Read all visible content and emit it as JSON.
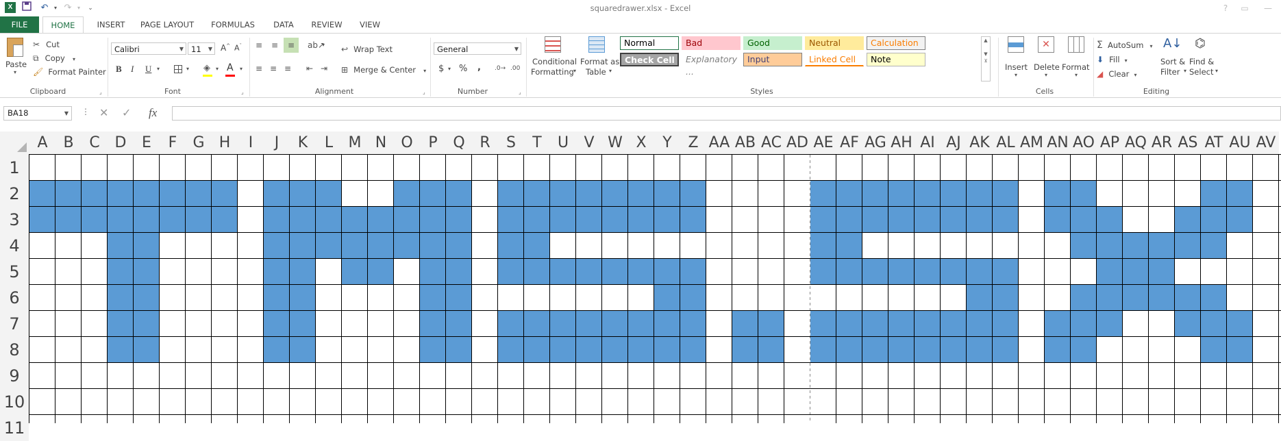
{
  "app": {
    "title": "squaredrawer.xlsx - Excel",
    "help": "?",
    "restore": "▭",
    "minimize": "—"
  },
  "tabs": [
    "FILE",
    "HOME",
    "INSERT",
    "PAGE LAYOUT",
    "FORMULAS",
    "DATA",
    "REVIEW",
    "VIEW"
  ],
  "active_tab": "HOME",
  "ribbon": {
    "clipboard": {
      "label": "Clipboard",
      "paste": "Paste",
      "cut": "Cut",
      "copy": "Copy",
      "format_painter": "Format Painter"
    },
    "font": {
      "label": "Font",
      "font_name": "Calibri",
      "font_size": "11",
      "bold": "B",
      "italic": "I",
      "underline": "U"
    },
    "alignment": {
      "label": "Alignment",
      "wrap_text": "Wrap Text",
      "merge_center": "Merge & Center"
    },
    "number": {
      "label": "Number",
      "format": "General",
      "currency": "$",
      "percent": "%",
      "comma": ","
    },
    "styles": {
      "label": "Styles",
      "conditional_formatting_1": "Conditional",
      "conditional_formatting_2": "Formatting",
      "format_as_table_1": "Format as",
      "format_as_table_2": "Table",
      "gallery": [
        {
          "name": "Normal",
          "bg": "#ffffff",
          "fg": "#000000",
          "border": "#217346"
        },
        {
          "name": "Bad",
          "bg": "#ffc7ce",
          "fg": "#9c0006",
          "border": "#ffc7ce"
        },
        {
          "name": "Good",
          "bg": "#c6efce",
          "fg": "#006100",
          "border": "#c6efce"
        },
        {
          "name": "Neutral",
          "bg": "#ffeb9c",
          "fg": "#9c5700",
          "border": "#ffeb9c"
        },
        {
          "name": "Calculation",
          "bg": "#f2f2f2",
          "fg": "#fa7d00",
          "border": "#7f7f7f"
        },
        {
          "name": "Check Cell",
          "bg": "#a5a5a5",
          "fg": "#ffffff",
          "border": "#3f3f3f"
        },
        {
          "name": "Explanatory ...",
          "bg": "#ffffff",
          "fg": "#7f7f7f",
          "border": "#ffffff"
        },
        {
          "name": "Input",
          "bg": "#ffcc99",
          "fg": "#3f3f76",
          "border": "#7f7f7f"
        },
        {
          "name": "Linked Cell",
          "bg": "#ffffff",
          "fg": "#fa7d00",
          "border": "#ffffff"
        },
        {
          "name": "Note",
          "bg": "#ffffcc",
          "fg": "#000000",
          "border": "#b2b2b2"
        }
      ]
    },
    "cells": {
      "label": "Cells",
      "insert": "Insert",
      "delete": "Delete",
      "format": "Format"
    },
    "editing": {
      "label": "Editing",
      "autosum": "AutoSum",
      "fill": "Fill",
      "clear": "Clear",
      "sort_1": "Sort &",
      "sort_2": "Filter",
      "find_1": "Find &",
      "find_2": "Select"
    }
  },
  "formula_bar": {
    "name_box": "BA18",
    "cancel": "✕",
    "enter": "✓",
    "fx": "fx",
    "value": ""
  },
  "sheet": {
    "fill_color": "#5b9bd5",
    "columns": [
      "A",
      "B",
      "C",
      "D",
      "E",
      "F",
      "G",
      "H",
      "I",
      "J",
      "K",
      "L",
      "M",
      "N",
      "O",
      "P",
      "Q",
      "R",
      "S",
      "T",
      "U",
      "V",
      "W",
      "X",
      "Y",
      "Z",
      "AA",
      "AB",
      "AC",
      "AD",
      "AE",
      "AF",
      "AG",
      "AH",
      "AI",
      "AJ",
      "AK",
      "AL",
      "AM",
      "AN",
      "AO",
      "AP",
      "AQ",
      "AR",
      "AS",
      "AT",
      "AU",
      "AV"
    ],
    "rows": [
      "1",
      "2",
      "3",
      "4",
      "5",
      "6",
      "7",
      "8",
      "9",
      "10",
      "11"
    ],
    "filled": {
      "2": [
        "A",
        "B",
        "C",
        "D",
        "E",
        "F",
        "G",
        "H",
        "J",
        "K",
        "L",
        "O",
        "P",
        "Q",
        "S",
        "T",
        "U",
        "V",
        "W",
        "X",
        "Y",
        "Z",
        "AE",
        "AF",
        "AG",
        "AH",
        "AI",
        "AJ",
        "AK",
        "AL",
        "AN",
        "AO",
        "AT",
        "AU"
      ],
      "3": [
        "A",
        "B",
        "C",
        "D",
        "E",
        "F",
        "G",
        "H",
        "J",
        "K",
        "L",
        "M",
        "N",
        "O",
        "P",
        "Q",
        "S",
        "T",
        "U",
        "V",
        "W",
        "X",
        "Y",
        "Z",
        "AE",
        "AF",
        "AG",
        "AH",
        "AI",
        "AJ",
        "AK",
        "AL",
        "AN",
        "AO",
        "AP",
        "AS",
        "AT",
        "AU"
      ],
      "4": [
        "D",
        "E",
        "J",
        "K",
        "L",
        "M",
        "N",
        "O",
        "P",
        "Q",
        "S",
        "T",
        "AE",
        "AF",
        "AO",
        "AP",
        "AQ",
        "AR",
        "AS",
        "AT"
      ],
      "5": [
        "D",
        "E",
        "J",
        "K",
        "M",
        "N",
        "P",
        "Q",
        "S",
        "T",
        "U",
        "V",
        "W",
        "X",
        "Y",
        "Z",
        "AE",
        "AF",
        "AG",
        "AH",
        "AI",
        "AJ",
        "AK",
        "AL",
        "AP",
        "AQ",
        "AR"
      ],
      "6": [
        "D",
        "E",
        "J",
        "K",
        "P",
        "Q",
        "Y",
        "Z",
        "AK",
        "AL",
        "AO",
        "AP",
        "AQ",
        "AR",
        "AS",
        "AT"
      ],
      "7": [
        "D",
        "E",
        "J",
        "K",
        "P",
        "Q",
        "S",
        "T",
        "U",
        "V",
        "W",
        "X",
        "Y",
        "Z",
        "AB",
        "AC",
        "AE",
        "AF",
        "AG",
        "AH",
        "AI",
        "AJ",
        "AK",
        "AL",
        "AN",
        "AO",
        "AP",
        "AS",
        "AT",
        "AU"
      ],
      "8": [
        "D",
        "E",
        "J",
        "K",
        "P",
        "Q",
        "S",
        "T",
        "U",
        "V",
        "W",
        "X",
        "Y",
        "Z",
        "AB",
        "AC",
        "AE",
        "AF",
        "AG",
        "AH",
        "AI",
        "AJ",
        "AK",
        "AL",
        "AN",
        "AO",
        "AT",
        "AU"
      ]
    }
  }
}
